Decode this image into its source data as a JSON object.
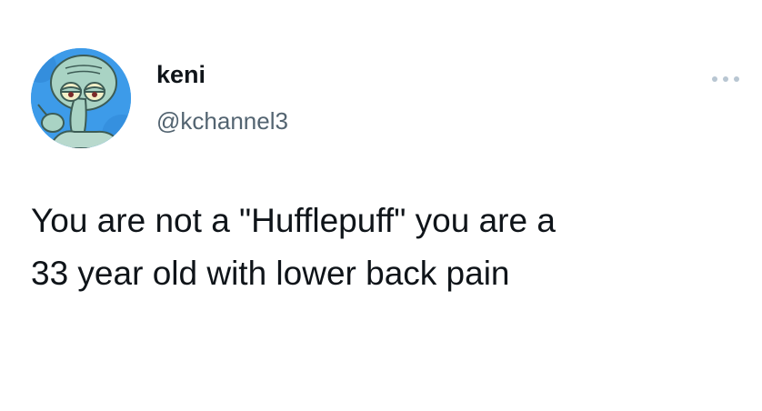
{
  "tweet": {
    "author": {
      "display_name": "keni",
      "handle": "@kchannel3",
      "avatar_icon": "squidward-avatar-icon"
    },
    "menu_icon": "more-options-icon",
    "text_lines": [
      "You are not a \"Hufflepuff\" you are a",
      "33 year old with lower back pain"
    ]
  },
  "colors": {
    "text_primary": "#0f1419",
    "text_secondary": "#536471",
    "avatar_background": "#3d9be9",
    "icon_muted": "#b8c6d2"
  }
}
